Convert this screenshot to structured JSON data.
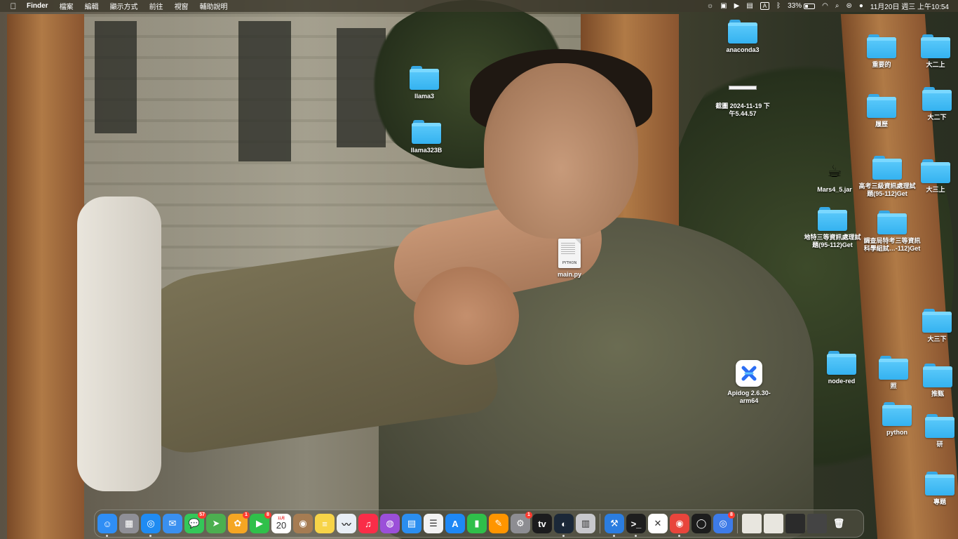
{
  "menubar": {
    "apple": "",
    "items": [
      "Finder",
      "檔案",
      "編輯",
      "顯示方式",
      "前往",
      "視窗",
      "輔助說明"
    ],
    "status": {
      "battery_percent": "33%",
      "battery_level": 0.33,
      "input_source": "A",
      "clock": "11月20日 週三 上午10:54"
    }
  },
  "desktop": {
    "items": [
      {
        "label": "anaconda3",
        "type": "folder"
      },
      {
        "label": "截圖 2024-11-19 下午5.44.57",
        "type": "screenshot"
      },
      {
        "label": "llama3",
        "type": "folder"
      },
      {
        "label": "llama323B",
        "type": "folder"
      },
      {
        "label": "main.py",
        "type": "python-file",
        "badge": "PYTHON"
      },
      {
        "label": "重要的",
        "type": "folder"
      },
      {
        "label": "大二上",
        "type": "folder"
      },
      {
        "label": "履歷",
        "type": "folder"
      },
      {
        "label": "大二下",
        "type": "folder"
      },
      {
        "label": "Mars4_5.jar",
        "type": "jar"
      },
      {
        "label": "高考三級資訊處理試題(95-112)Get",
        "type": "folder"
      },
      {
        "label": "大三上",
        "type": "folder"
      },
      {
        "label": "地特三等資訊處理試題(95-112)Get",
        "type": "folder"
      },
      {
        "label": "調查局特考三等資訊科學組試…-112)Get",
        "type": "folder"
      },
      {
        "label": "大三下",
        "type": "folder"
      },
      {
        "label": "node-red",
        "type": "folder"
      },
      {
        "label": "照",
        "type": "folder"
      },
      {
        "label": "推甄",
        "type": "folder"
      },
      {
        "label": "Apidog 2.6.30-arm64",
        "type": "app"
      },
      {
        "label": "python",
        "type": "folder"
      },
      {
        "label": "研",
        "type": "folder"
      },
      {
        "label": "專題",
        "type": "folder"
      }
    ]
  },
  "dock": {
    "apps": [
      {
        "name": "finder-icon",
        "glyph": "☺",
        "color": "#2f8ef5",
        "running": true
      },
      {
        "name": "launchpad-icon",
        "glyph": "▦",
        "color": "#8f8f96"
      },
      {
        "name": "safari-icon",
        "glyph": "◎",
        "color": "#1f8bf2",
        "running": true
      },
      {
        "name": "mail-icon",
        "glyph": "✉",
        "color": "#3a90f0"
      },
      {
        "name": "messages-icon",
        "glyph": "💬",
        "color": "#34c759",
        "badge": "57"
      },
      {
        "name": "maps-icon",
        "glyph": "➤",
        "color": "#4caf50"
      },
      {
        "name": "photos-icon",
        "glyph": "✿",
        "color": "#f5a623",
        "badge": "1"
      },
      {
        "name": "facetime-icon",
        "glyph": "▶",
        "color": "#30c04a",
        "badge": "8"
      },
      {
        "name": "calendar-icon",
        "glyph": "",
        "color": "#ffffff",
        "calendar": true,
        "month": "11月",
        "day": "20"
      },
      {
        "name": "contacts-icon",
        "glyph": "◉",
        "color": "#a67c52"
      },
      {
        "name": "notes-icon",
        "glyph": "≡",
        "color": "#f7d448"
      },
      {
        "name": "freeform-icon",
        "glyph": "〰",
        "color": "#e8eef5"
      },
      {
        "name": "music-icon",
        "glyph": "♫",
        "color": "#fa2d48"
      },
      {
        "name": "podcasts-icon",
        "glyph": "◍",
        "color": "#9b4fd9"
      },
      {
        "name": "keynote-icon",
        "glyph": "▤",
        "color": "#2b8ef0"
      },
      {
        "name": "reminders-icon",
        "glyph": "☰",
        "color": "#f2f2f2"
      },
      {
        "name": "app-store-icon",
        "glyph": "A",
        "color": "#1e88f5"
      },
      {
        "name": "numbers-icon",
        "glyph": "▮",
        "color": "#2fbf4a"
      },
      {
        "name": "pages-icon",
        "glyph": "✎",
        "color": "#ff9500"
      },
      {
        "name": "system-settings-icon",
        "glyph": "⚙",
        "color": "#8d8d92",
        "badge": "1"
      },
      {
        "name": "apple-tv-icon",
        "glyph": "tv",
        "color": "#1c1c1e"
      },
      {
        "name": "steam-icon",
        "glyph": "◐",
        "color": "#1b2838",
        "running": true
      },
      {
        "name": "pdf-reader-icon",
        "glyph": "▥",
        "color": "#c8c8cc"
      },
      {
        "separator": true
      },
      {
        "name": "xcode-icon",
        "glyph": "⚒",
        "color": "#2b7de0",
        "running": true
      },
      {
        "name": "terminal-icon",
        "glyph": ">_",
        "color": "#1e1e1e",
        "running": true
      },
      {
        "name": "apidog-dock-icon",
        "glyph": "✕",
        "color": "#ffffff"
      },
      {
        "name": "chrome-icon",
        "glyph": "◉",
        "color": "#e8453c",
        "running": true
      },
      {
        "name": "activity-ring-icon",
        "glyph": "◯",
        "color": "#1d1d1d"
      },
      {
        "name": "safari-technology-preview-icon",
        "glyph": "◎",
        "color": "#3d7be8",
        "badge": "8"
      },
      {
        "separator": true
      },
      {
        "name": "downloads-stack-icon",
        "glyph": "",
        "color": "#e8e6df",
        "thumb": true
      },
      {
        "name": "recent-screenshot-1-icon",
        "glyph": "",
        "color": "#e8e6df",
        "thumb": true
      },
      {
        "name": "recent-screenshot-2-icon",
        "glyph": "",
        "color": "#2b2b2b",
        "thumb": true
      },
      {
        "name": "recent-screenshot-3-icon",
        "glyph": "",
        "color": "#444444",
        "thumb": true
      },
      {
        "name": "trash-icon",
        "glyph": "🗑",
        "color": "transparent"
      }
    ]
  }
}
